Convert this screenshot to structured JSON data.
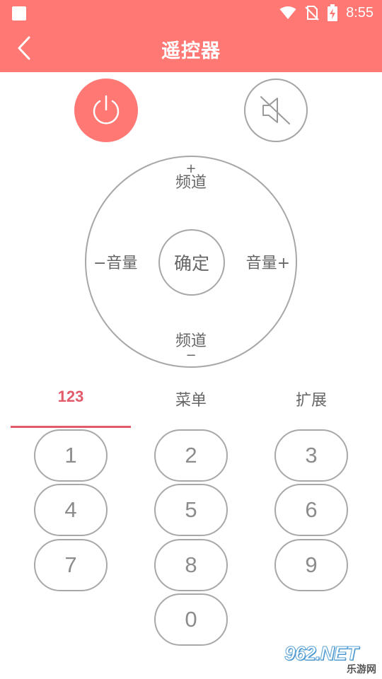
{
  "status_bar": {
    "time": "8:55",
    "icons": [
      "app-notification-icon",
      "wifi-icon",
      "no-sim-icon",
      "battery-charging-icon"
    ]
  },
  "app_bar": {
    "title": "遥控器",
    "back_icon": "chevron-left-icon",
    "background_color": "#ff7873"
  },
  "top_buttons": {
    "power_icon": "power-icon",
    "mute_icon": "volume-mute-icon",
    "power_color": "#ff7873"
  },
  "dpad": {
    "channel_up_symbol": "+",
    "channel_up_label": "频道",
    "channel_down_label": "频道",
    "channel_down_symbol": "−",
    "volume_down_label": "−音量",
    "volume_up_label": "音量+",
    "ok_label": "确定"
  },
  "tabs": {
    "items": [
      "123",
      "菜单",
      "扩展"
    ],
    "active_index": 0,
    "accent_color": "#e35a6a"
  },
  "keypad": {
    "keys": [
      "1",
      "2",
      "3",
      "4",
      "5",
      "6",
      "7",
      "8",
      "9",
      "0"
    ]
  },
  "watermark": {
    "main": "962.NET",
    "sub": "乐游网"
  }
}
